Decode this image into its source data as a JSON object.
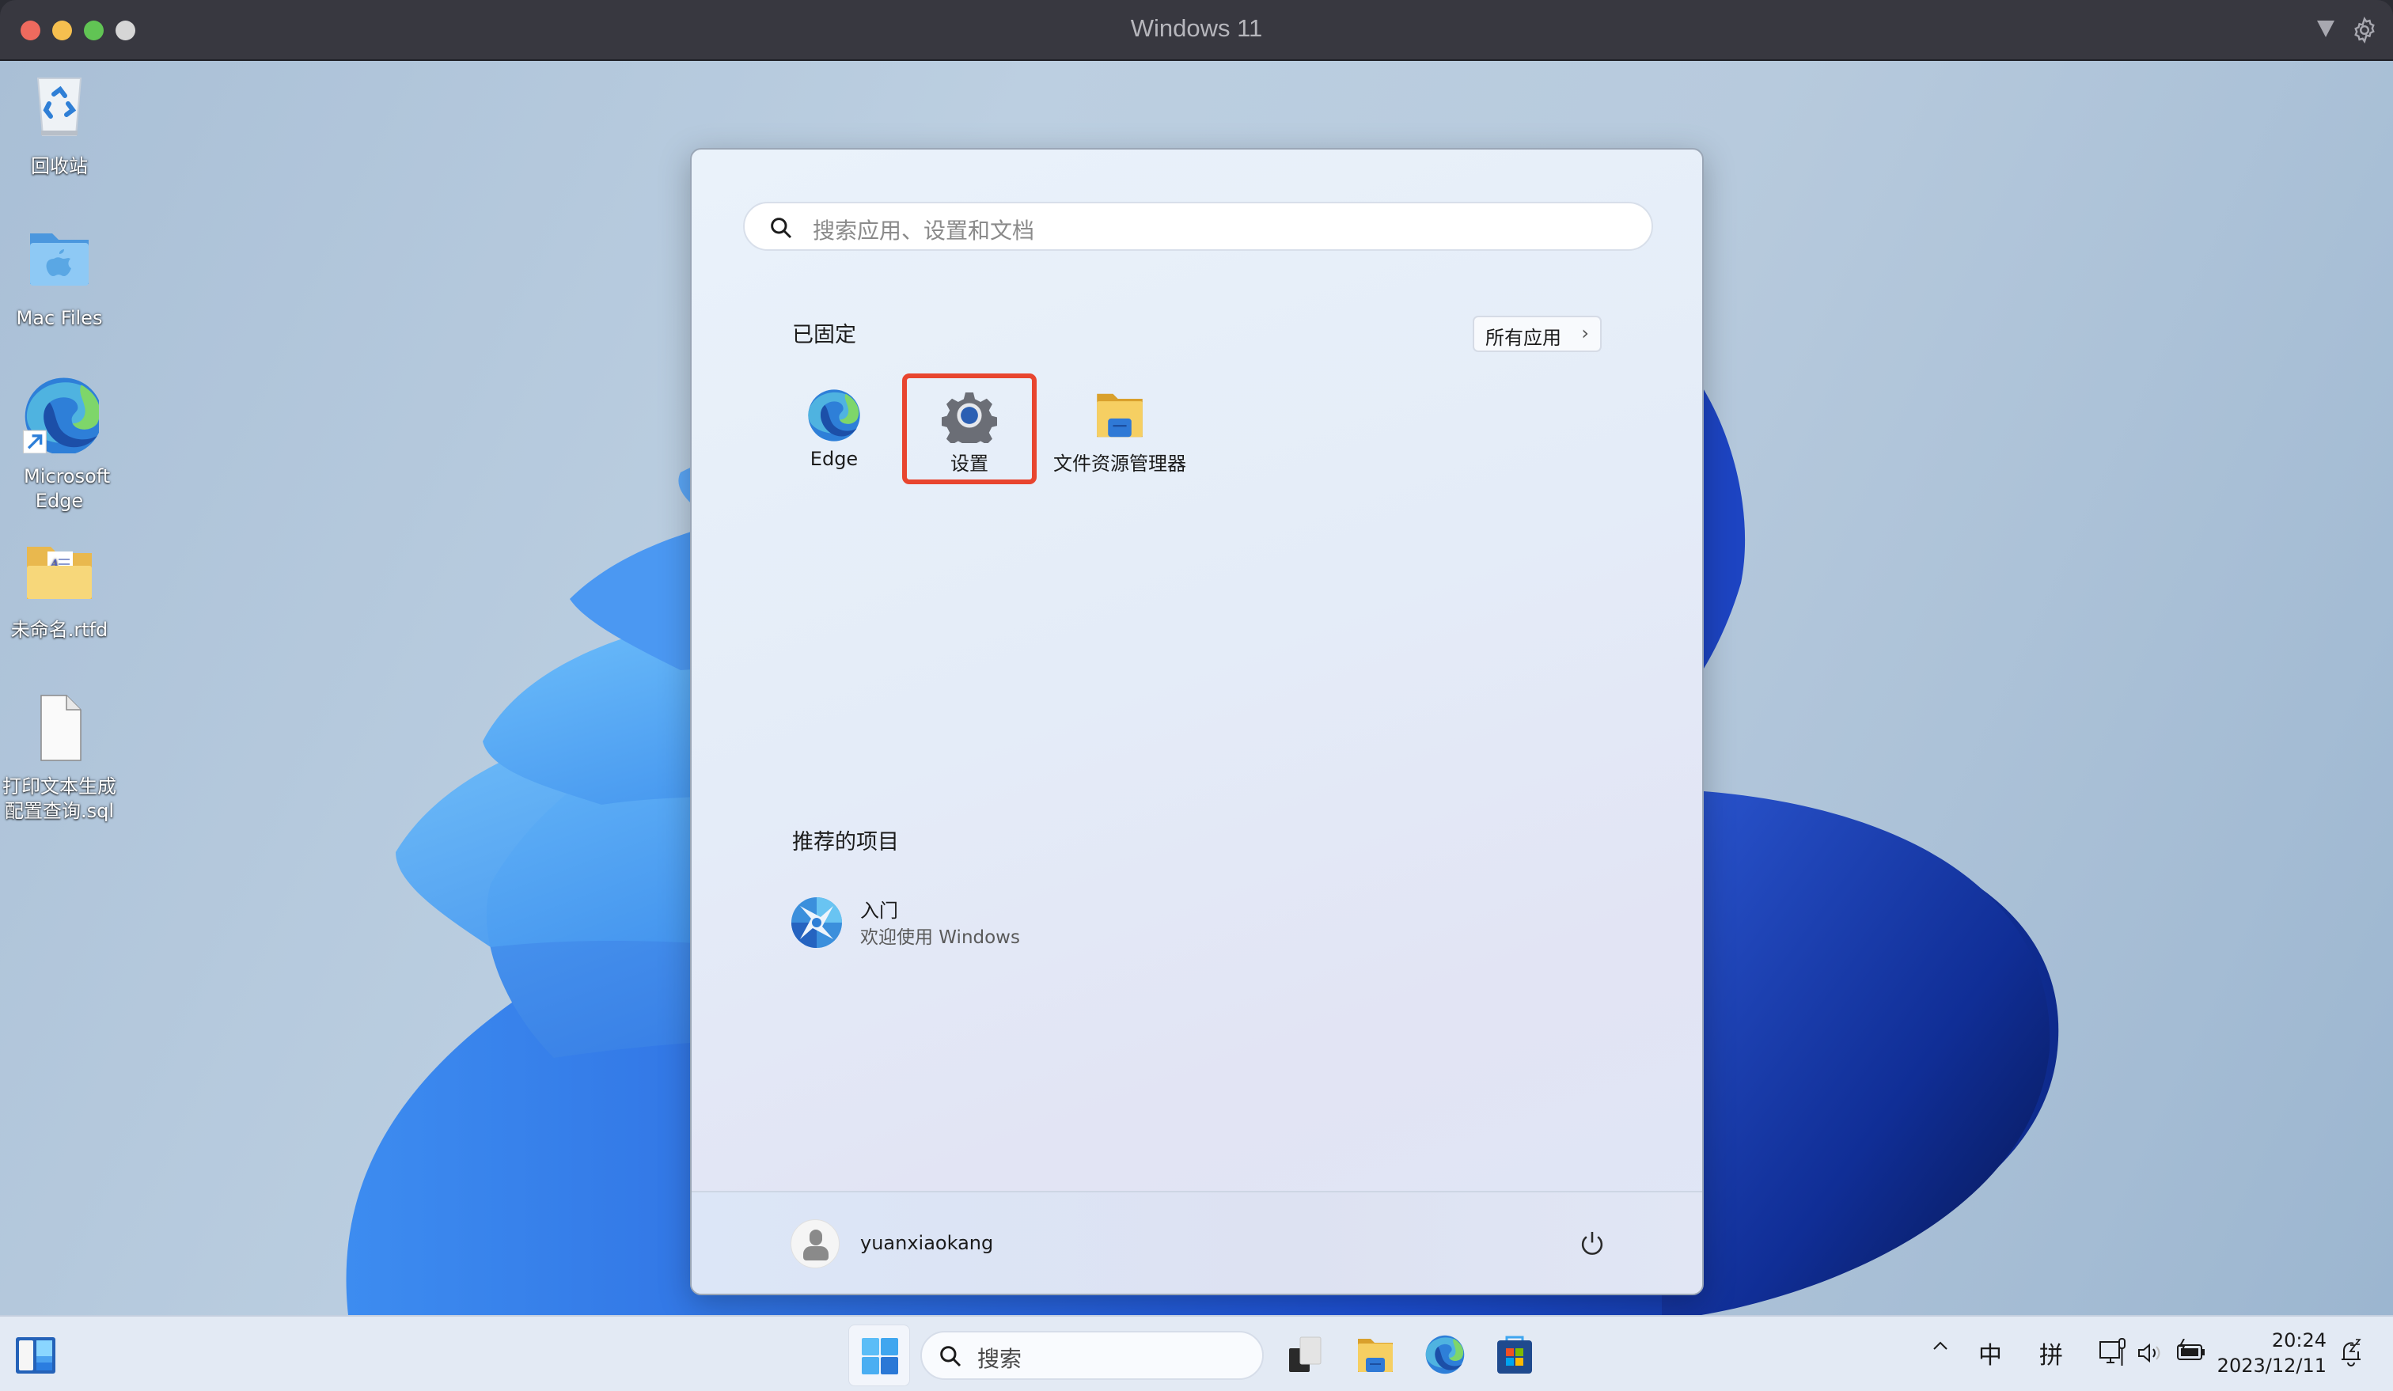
{
  "window": {
    "title": "Windows 11",
    "controls": [
      "close",
      "minimize",
      "zoom",
      "fullscreen"
    ],
    "toolbar_icons": [
      "dropdown-icon",
      "gear-icon"
    ]
  },
  "desktop": {
    "icons": [
      {
        "name": "recycle-bin",
        "label": "回收站",
        "icon": "recycle-bin-icon"
      },
      {
        "name": "mac-files",
        "label": "Mac Files",
        "icon": "folder-apple-icon"
      },
      {
        "name": "microsoft-edge",
        "label": "Microsoft Edge",
        "icon": "edge-shortcut-icon"
      },
      {
        "name": "untitled-rtfd",
        "label": "未命名.rtfd",
        "icon": "folder-document-icon"
      },
      {
        "name": "sql-file",
        "label": "打印文本生成配置查询.sql",
        "icon": "blank-file-icon"
      }
    ]
  },
  "start_menu": {
    "search": {
      "placeholder": "搜索应用、设置和文档",
      "value": ""
    },
    "pinned": {
      "title": "已固定",
      "all_apps_label": "所有应用",
      "all_apps_chevron": "›",
      "apps": [
        {
          "label": "Edge",
          "icon": "edge-icon",
          "highlighted": false
        },
        {
          "label": "设置",
          "icon": "settings-gear-icon",
          "highlighted": true
        },
        {
          "label": "文件资源管理器",
          "icon": "file-explorer-icon",
          "highlighted": false
        }
      ]
    },
    "recommended": {
      "title": "推荐的项目",
      "items": [
        {
          "title": "入门",
          "subtitle": "欢迎使用 Windows",
          "icon": "get-started-icon"
        }
      ]
    },
    "footer": {
      "username": "yuanxiaokang",
      "power_icon": "power-icon"
    }
  },
  "taskbar": {
    "search_label": "搜索",
    "apps": [
      "task-view-icon",
      "file-explorer-icon",
      "edge-icon",
      "microsoft-store-icon"
    ],
    "tray": {
      "chevron": "^",
      "ime_mode": "中",
      "ime_method": "拼",
      "icons": [
        "network-icon",
        "volume-icon",
        "battery-charging-icon"
      ]
    },
    "time": "20:24",
    "date": "2023/12/11",
    "notification_icon": "notification-bell-snooze-icon"
  },
  "colors": {
    "highlight_border": "#e8452f",
    "titlebar": "#383840"
  }
}
